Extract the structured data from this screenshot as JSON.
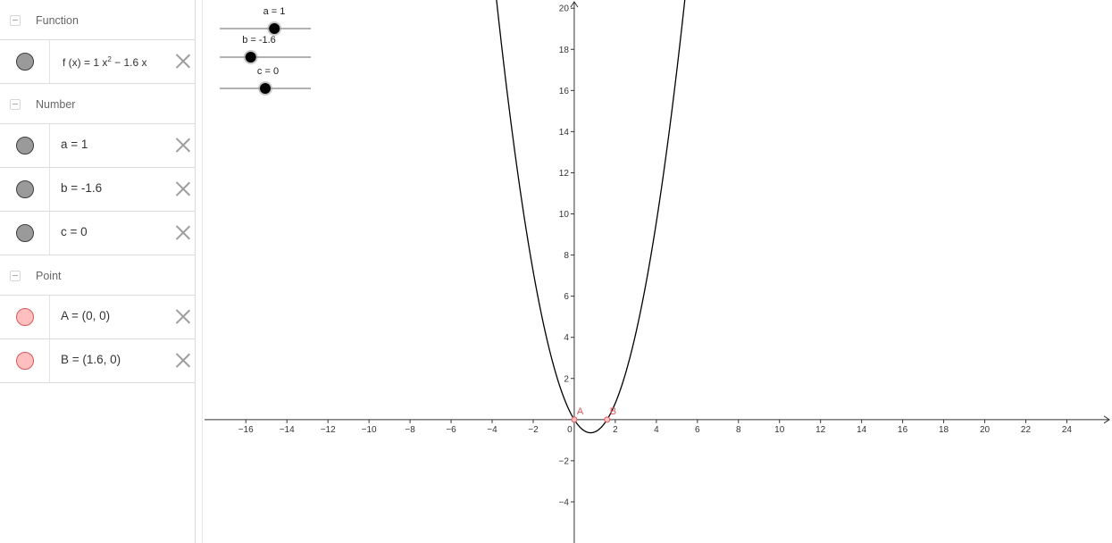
{
  "algebra": {
    "groups": [
      {
        "title": "Function"
      },
      {
        "title": "Number"
      },
      {
        "title": "Point"
      }
    ],
    "function_item": {
      "prefix": "f (x)  =  1 x",
      "exponent": "2",
      "suffix": " − 1.6 x"
    },
    "number_items": [
      {
        "text": "a  =  1"
      },
      {
        "text": "b  =  -1.6"
      },
      {
        "text": "c  =  0"
      }
    ],
    "point_items": [
      {
        "text": "A  =  (0, 0)"
      },
      {
        "text": "B  =  (1.6, 0)"
      }
    ]
  },
  "graphics": {
    "function": {
      "a": 1,
      "b": -1.6,
      "c": 0,
      "color": "#000000"
    },
    "x_axis": {
      "ticks": [
        -16,
        -14,
        -12,
        -10,
        -8,
        -6,
        -4,
        -2,
        0,
        2,
        4,
        6,
        8,
        10,
        12,
        14,
        16,
        18,
        20,
        22,
        24
      ],
      "range": [
        -18.1,
        26.2
      ]
    },
    "y_axis": {
      "ticks": [
        -4,
        -2,
        2,
        4,
        6,
        8,
        10,
        12,
        14,
        16,
        18,
        20
      ],
      "range": [
        -6.0,
        20.4
      ]
    },
    "sliders": [
      {
        "label": "a = 1",
        "value": 1
      },
      {
        "label": "b = -1.6",
        "value": -1.6
      },
      {
        "label": "c = 0",
        "value": 0
      }
    ],
    "points": [
      {
        "name": "A",
        "x": 0,
        "y": 0
      },
      {
        "name": "B",
        "x": 1.6,
        "y": 0
      }
    ],
    "colors": {
      "axis": "#333333",
      "point_fill": "#ffbfbf",
      "point_stroke": "#d9585a",
      "slider_line": "#666666",
      "slider_knob": "#000000"
    }
  }
}
